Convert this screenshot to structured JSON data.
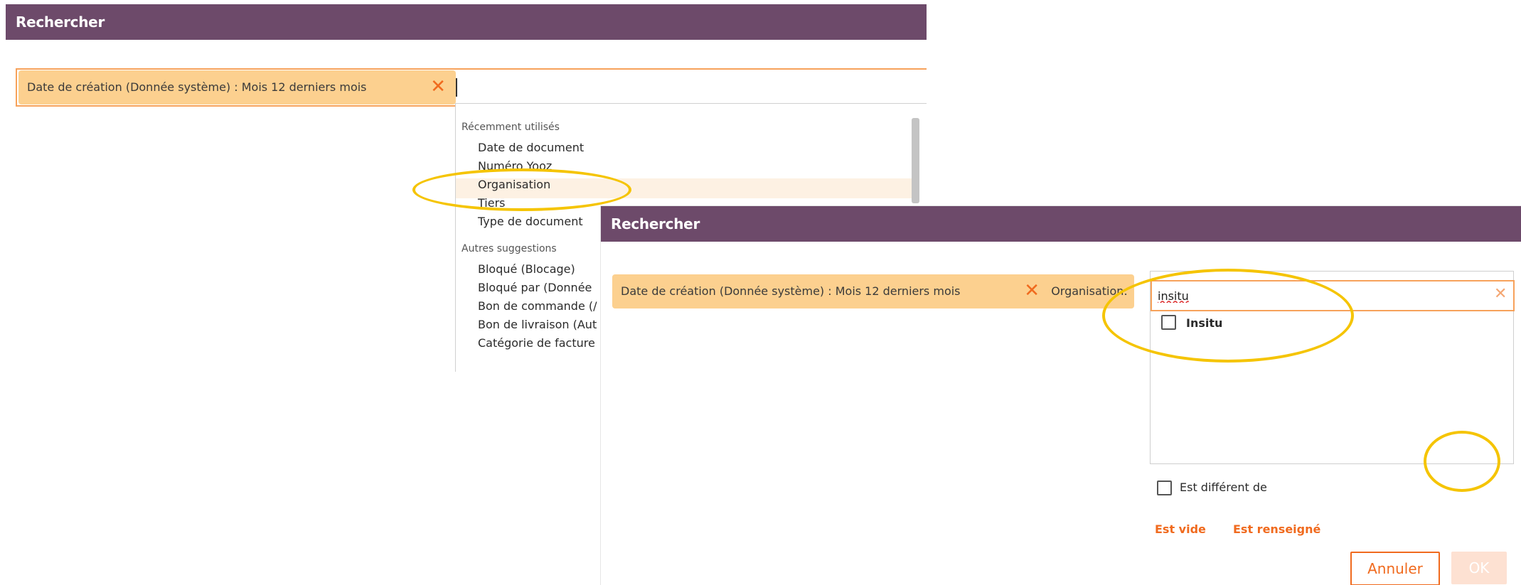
{
  "panel1": {
    "title": "Rechercher",
    "chip_label": "Date de création (Donnée système) : Mois 12 derniers mois",
    "chip_remove_icon": "close-icon",
    "dropdown": {
      "recent_title": "Récemment utilisés",
      "recent_items": [
        "Date de document",
        "Numéro Yooz",
        "Organisation",
        "Tiers",
        "Type de document"
      ],
      "other_title": "Autres suggestions",
      "other_items": [
        "Bloqué (Blocage)",
        "Bloqué par (Donnée",
        "Bon de commande (/",
        "Bon de livraison (Aut",
        "Catégorie de facture"
      ]
    }
  },
  "panel2": {
    "title": "Rechercher",
    "chip_label": "Date de création (Donnée système) : Mois 12 derniers mois",
    "chip_remove_icon": "close-icon",
    "field_label": "Organisation:",
    "search_value": "insitu",
    "clear_icon": "close-icon",
    "options": [
      {
        "label": "Insitu",
        "checked": false
      }
    ],
    "not_equal_label": "Est différent de",
    "empty_link": "Est vide",
    "filled_link": "Est renseigné",
    "cancel_label": "Annuler",
    "ok_label": "OK"
  },
  "colors": {
    "titlebar": "#6d4a6a",
    "chip": "#fcd08f",
    "accent": "#f06a1e",
    "annotation": "#f5c400"
  }
}
